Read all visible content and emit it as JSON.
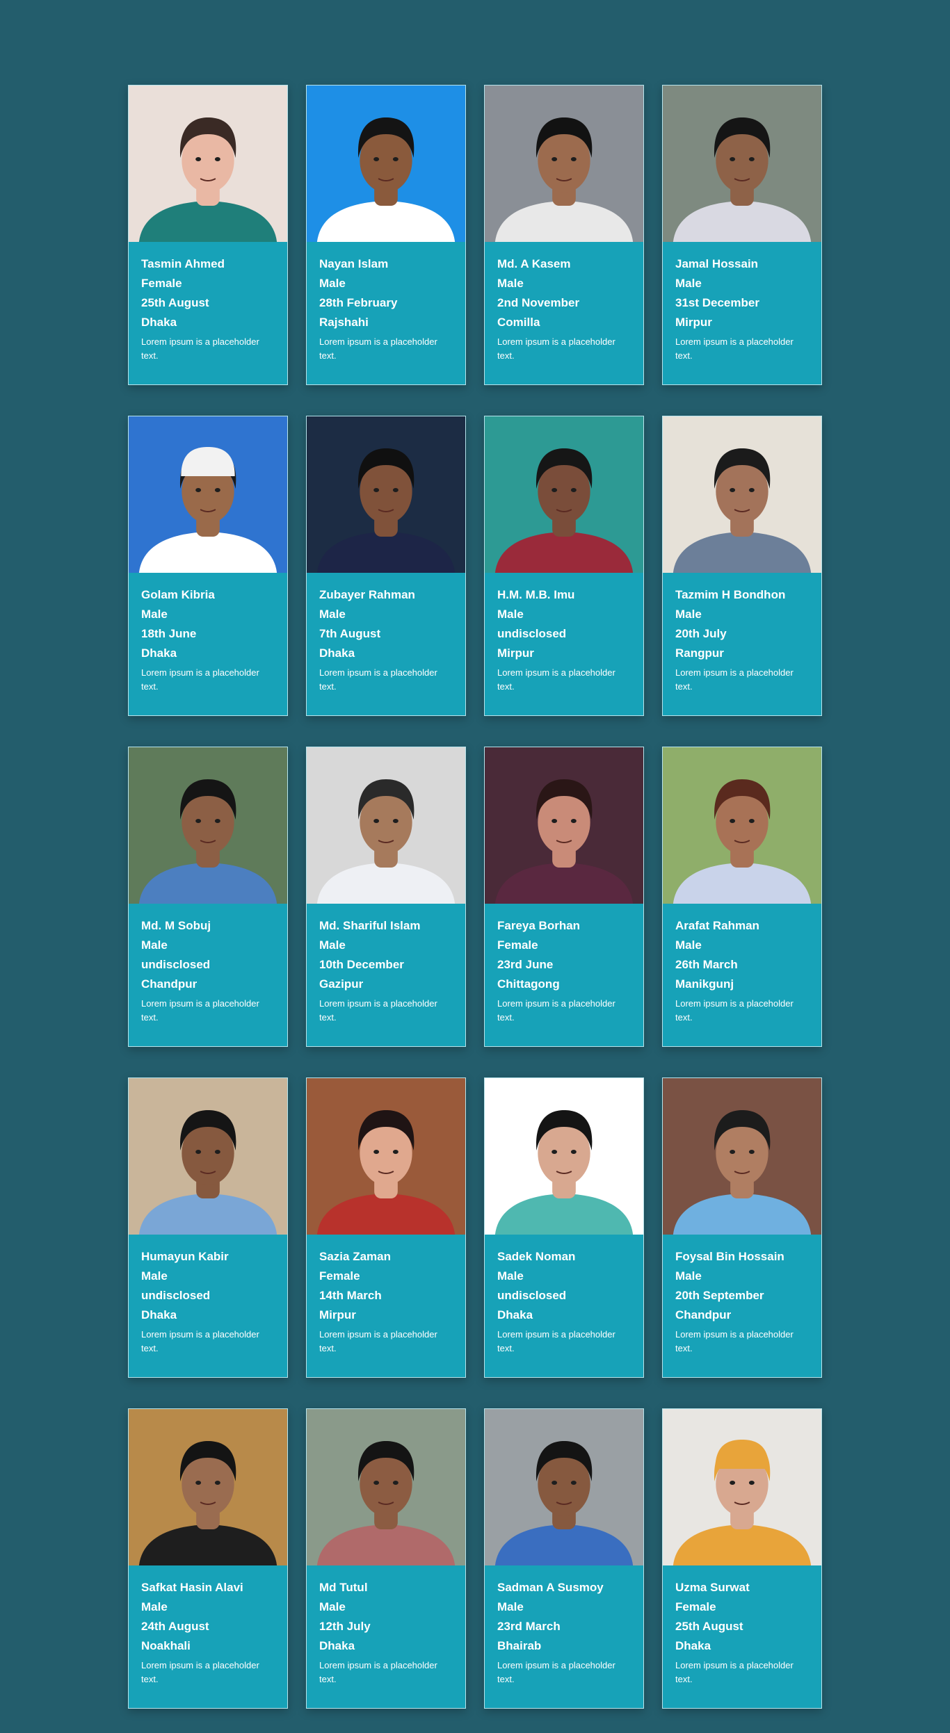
{
  "cards": [
    {
      "name": "Tasmin Ahmed",
      "gender": "Female",
      "birthday": "25th August",
      "city": "Dhaka",
      "desc": "Lorem ipsum is a placeholder text.",
      "bg": "#eadfd9",
      "skin": "#e9b8a4",
      "hair": "#3a2a25",
      "shirt": "#1f7f7a",
      "hat": ""
    },
    {
      "name": "Nayan Islam",
      "gender": "Male",
      "birthday": "28th February",
      "city": "Rajshahi",
      "desc": "Lorem ipsum is a placeholder text.",
      "bg": "#1e8fe6",
      "skin": "#8a5a3c",
      "hair": "#141414",
      "shirt": "#ffffff",
      "hat": ""
    },
    {
      "name": "Md. A Kasem",
      "gender": "Male",
      "birthday": "2nd November",
      "city": "Comilla",
      "desc": "Lorem ipsum is a placeholder text.",
      "bg": "#8a8f96",
      "skin": "#9c6b4e",
      "hair": "#121212",
      "shirt": "#e8e8e8",
      "hat": ""
    },
    {
      "name": "Jamal Hossain",
      "gender": "Male",
      "birthday": "31st December",
      "city": "Mirpur",
      "desc": "Lorem ipsum is a placeholder text.",
      "bg": "#7e8a80",
      "skin": "#8e6248",
      "hair": "#151515",
      "shirt": "#d9d9e2",
      "hat": ""
    },
    {
      "name": "Golam Kibria",
      "gender": "Male",
      "birthday": "18th June",
      "city": "Dhaka",
      "desc": "Lorem ipsum is a placeholder text.",
      "bg": "#2f74d0",
      "skin": "#9a6a4a",
      "hair": "#1a1a1a",
      "shirt": "#ffffff",
      "hat": "#f2f2f2"
    },
    {
      "name": "Zubayer Rahman",
      "gender": "Male",
      "birthday": "7th August",
      "city": "Dhaka",
      "desc": "Lorem ipsum is a placeholder text.",
      "bg": "#1c2c44",
      "skin": "#80523a",
      "hair": "#101010",
      "shirt": "#1d2547",
      "hat": ""
    },
    {
      "name": "H.M. M.B. Imu",
      "gender": "Male",
      "birthday": "undisclosed",
      "city": "Mirpur",
      "desc": "Lorem ipsum is a placeholder text.",
      "bg": "#2d9a94",
      "skin": "#7a4d3a",
      "hair": "#161616",
      "shirt": "#9a2a3a",
      "hat": ""
    },
    {
      "name": "Tazmim H Bondhon",
      "gender": "Male",
      "birthday": "20th July",
      "city": "Rangpur",
      "desc": "Lorem ipsum is a placeholder text.",
      "bg": "#e6e1d8",
      "skin": "#a3735a",
      "hair": "#1b1b1b",
      "shirt": "#6c7f99",
      "hat": ""
    },
    {
      "name": "Md. M Sobuj",
      "gender": "Male",
      "birthday": "undisclosed",
      "city": "Chandpur",
      "desc": "Lorem ipsum is a placeholder text.",
      "bg": "#5f7b5a",
      "skin": "#8c5f45",
      "hair": "#151515",
      "shirt": "#4c7fc0",
      "hat": ""
    },
    {
      "name": "Md. Shariful Islam",
      "gender": "Male",
      "birthday": "10th December",
      "city": "Gazipur",
      "desc": "Lorem ipsum is a placeholder text.",
      "bg": "#d8d8d8",
      "skin": "#a67a5c",
      "hair": "#2a2a2a",
      "shirt": "#eef0f4",
      "hat": ""
    },
    {
      "name": "Fareya Borhan",
      "gender": "Female",
      "birthday": "23rd June",
      "city": "Chittagong",
      "desc": "Lorem ipsum is a placeholder text.",
      "bg": "#4a2a38",
      "skin": "#c98b78",
      "hair": "#2a1616",
      "shirt": "#5a2840",
      "hat": ""
    },
    {
      "name": "Arafat Rahman",
      "gender": "Male",
      "birthday": "26th March",
      "city": "Manikgunj",
      "desc": "Lorem ipsum is a placeholder text.",
      "bg": "#8fae6a",
      "skin": "#a87256",
      "hair": "#5a2a1e",
      "shirt": "#c9d3ea",
      "hat": ""
    },
    {
      "name": "Humayun Kabir",
      "gender": "Male",
      "birthday": "undisclosed",
      "city": "Dhaka",
      "desc": "Lorem ipsum is a placeholder text.",
      "bg": "#c9b59a",
      "skin": "#86593f",
      "hair": "#151515",
      "shirt": "#7aa6d6",
      "hat": ""
    },
    {
      "name": "Sazia Zaman",
      "gender": "Female",
      "birthday": "14th March",
      "city": "Mirpur",
      "desc": "Lorem ipsum is a placeholder text.",
      "bg": "#9a5a3a",
      "skin": "#e0a88e",
      "hair": "#1f1414",
      "shirt": "#b8322c",
      "hat": ""
    },
    {
      "name": "Sadek Noman",
      "gender": "Male",
      "birthday": "undisclosed",
      "city": "Dhaka",
      "desc": "Lorem ipsum is a placeholder text.",
      "bg": "#ffffff",
      "skin": "#d8a890",
      "hair": "#141414",
      "shirt": "#4fb8b0",
      "hat": ""
    },
    {
      "name": "Foysal Bin Hossain",
      "gender": "Male",
      "birthday": "20th September",
      "city": "Chandpur",
      "desc": "Lorem ipsum is a placeholder text.",
      "bg": "#7a5244",
      "skin": "#b07e62",
      "hair": "#1c1c1c",
      "shirt": "#6fb0e0",
      "hat": ""
    },
    {
      "name": "Safkat Hasin Alavi",
      "gender": "Male",
      "birthday": "24th August",
      "city": "Noakhali",
      "desc": "Lorem ipsum is a placeholder text.",
      "bg": "#b88a4a",
      "skin": "#9a6c50",
      "hair": "#141414",
      "shirt": "#1e1e1e",
      "hat": ""
    },
    {
      "name": "Md Tutul",
      "gender": "Male",
      "birthday": "12th July",
      "city": "Dhaka",
      "desc": "Lorem ipsum is a placeholder text.",
      "bg": "#8a9a8a",
      "skin": "#8c5c42",
      "hair": "#141414",
      "shirt": "#b06a6a",
      "hat": ""
    },
    {
      "name": "Sadman A Susmoy",
      "gender": "Male",
      "birthday": "23rd March",
      "city": "Bhairab",
      "desc": "Lorem ipsum is a placeholder text.",
      "bg": "#9aa0a4",
      "skin": "#86593f",
      "hair": "#141414",
      "shirt": "#3a6ec0",
      "hat": ""
    },
    {
      "name": "Uzma Surwat",
      "gender": "Female",
      "birthday": "25th August",
      "city": "Dhaka",
      "desc": "Lorem ipsum is a placeholder text.",
      "bg": "#e8e6e2",
      "skin": "#d8a890",
      "hair": "#e8a43a",
      "shirt": "#e8a43a",
      "hat": "#e8a43a"
    }
  ]
}
